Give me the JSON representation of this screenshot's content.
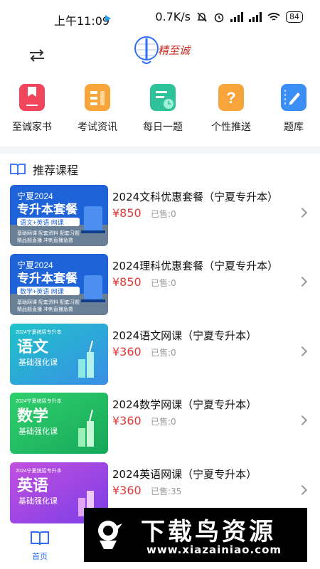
{
  "status_bar": {
    "time": "上午11:09",
    "net_speed": "0.7K/s",
    "battery": "84"
  },
  "header": {
    "logo_text": "精至诚"
  },
  "categories": [
    {
      "label": "至诚家书",
      "icon": "bookmark-book-icon",
      "color": "#f0455a"
    },
    {
      "label": "考试资讯",
      "icon": "document-list-icon",
      "color": "#f7a53a"
    },
    {
      "label": "每日一题",
      "icon": "daily-clock-icon",
      "color": "#2ec29a"
    },
    {
      "label": "个性推送",
      "icon": "question-icon",
      "color": "#f7a53a"
    },
    {
      "label": "题库",
      "icon": "notebook-pen-icon",
      "color": "#3b8ef5"
    }
  ],
  "section": {
    "title": "推荐课程"
  },
  "courses": [
    {
      "title": "2024文科优惠套餐（宁夏专升本）",
      "price": "¥850",
      "sold": "已售:0",
      "thumb": {
        "top": "宁夏2024",
        "main": "专升本套餐",
        "sub": "语文+英语 网课",
        "l1": "基础网课  配套资料  配套习题",
        "l2": "精品题直播  冲刺直播急救",
        "style": "blue"
      }
    },
    {
      "title": "2024理科优惠套餐（宁夏专升本）",
      "price": "¥850",
      "sold": "已售:0",
      "thumb": {
        "top": "宁夏2024",
        "main": "专升本套餐",
        "sub": "数学+英语 网课",
        "l1": "基础网课  配套资料  配套习题",
        "l2": "精品题直播  冲刺直播急救",
        "style": "blue"
      }
    },
    {
      "title": "2024语文网课（宁夏专升本）",
      "price": "¥360",
      "sold": "已售:0",
      "thumb": {
        "top": "2024宁夏统招专升本",
        "main": "语文",
        "sub": "基础强化课",
        "style": "teal"
      }
    },
    {
      "title": "2024数学网课（宁夏专升本）",
      "price": "¥360",
      "sold": "已售:0",
      "thumb": {
        "top": "2024宁夏统招专升本",
        "main": "数学",
        "sub": "基础强化课",
        "style": "green"
      }
    },
    {
      "title": "2024英语网课（宁夏专升本）",
      "price": "¥360",
      "sold": "已售:35",
      "thumb": {
        "top": "2024宁夏统招专升本",
        "main": "英语",
        "sub": "基础强化课",
        "style": "purple"
      }
    }
  ],
  "bottom_nav": {
    "home_label": "首页"
  },
  "watermark": {
    "title": "下载鸟资源",
    "url": "www.xiazainiao.com"
  }
}
